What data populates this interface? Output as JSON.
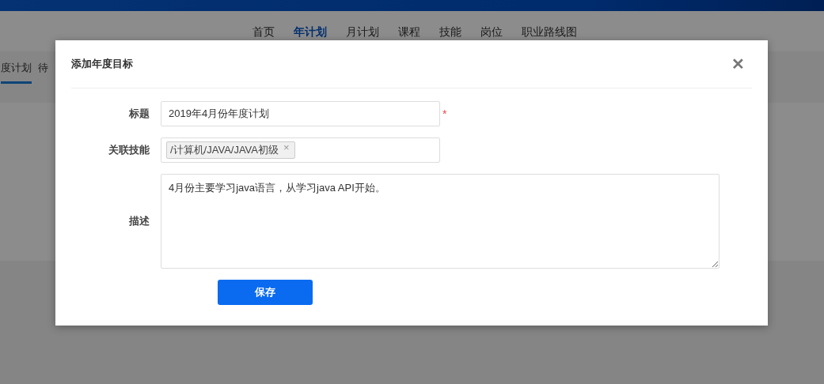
{
  "nav": [
    {
      "label": "首页",
      "selected": false
    },
    {
      "label": "年计划",
      "selected": true
    },
    {
      "label": "月计划",
      "selected": false
    },
    {
      "label": "课程",
      "selected": false
    },
    {
      "label": "技能",
      "selected": false
    },
    {
      "label": "岗位",
      "selected": false
    },
    {
      "label": "职业路线图",
      "selected": false
    }
  ],
  "subtabs": [
    {
      "label": "度计划",
      "selected": true
    },
    {
      "label": "待",
      "selected": false
    }
  ],
  "dialog": {
    "title": "添加年度目标",
    "close": "✕",
    "fields": [
      {
        "kind": "text",
        "label": "标题",
        "value": "2019年4月份年度计划",
        "required": true,
        "required_mark": "*"
      },
      {
        "kind": "tags",
        "label": "关联技能",
        "tags": [
          {
            "label": "/计算机/JAVA/JAVA初级",
            "remove": "×"
          }
        ]
      },
      {
        "kind": "textarea",
        "label": "描述",
        "value": "4月份主要学习java语言，从学习java API开始。"
      }
    ],
    "save": "保存"
  }
}
